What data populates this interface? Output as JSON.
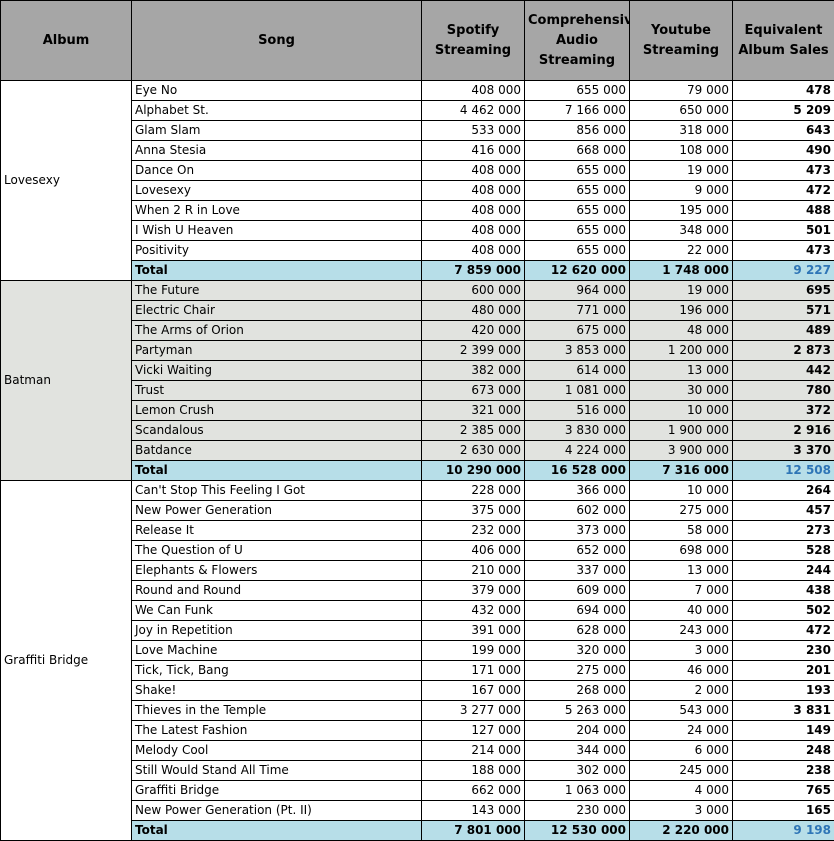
{
  "colors": {
    "header_bg": "#a6a6a6",
    "total_bg": "#b7dee8",
    "total_eas_text": "#2e75b6",
    "alt_group_bg": "#e1e3df",
    "border": "#000000"
  },
  "headers": {
    "album": "Album",
    "song": "Song",
    "spotify": [
      "Spotify",
      "Streaming"
    ],
    "caus": [
      "Comprehensive",
      "Audio",
      "Streaming"
    ],
    "youtube": [
      "Youtube",
      "Streaming"
    ],
    "eas": [
      "Equivalent",
      "Album Sales"
    ]
  },
  "albums": [
    {
      "name": "Lovesexy",
      "shaded": false,
      "songs": [
        {
          "song": "Eye No",
          "spotify": "408 000",
          "caus": "655 000",
          "youtube": "79 000",
          "eas": "478"
        },
        {
          "song": "Alphabet St.",
          "spotify": "4 462 000",
          "caus": "7 166 000",
          "youtube": "650 000",
          "eas": "5 209"
        },
        {
          "song": "Glam Slam",
          "spotify": "533 000",
          "caus": "856 000",
          "youtube": "318 000",
          "eas": "643"
        },
        {
          "song": "Anna Stesia",
          "spotify": "416 000",
          "caus": "668 000",
          "youtube": "108 000",
          "eas": "490"
        },
        {
          "song": "Dance On",
          "spotify": "408 000",
          "caus": "655 000",
          "youtube": "19 000",
          "eas": "473"
        },
        {
          "song": "Lovesexy",
          "spotify": "408 000",
          "caus": "655 000",
          "youtube": "9 000",
          "eas": "472"
        },
        {
          "song": "When 2 R in Love",
          "spotify": "408 000",
          "caus": "655 000",
          "youtube": "195 000",
          "eas": "488"
        },
        {
          "song": "I Wish U Heaven",
          "spotify": "408 000",
          "caus": "655 000",
          "youtube": "348 000",
          "eas": "501"
        },
        {
          "song": "Positivity",
          "spotify": "408 000",
          "caus": "655 000",
          "youtube": "22 000",
          "eas": "473"
        }
      ],
      "total": {
        "label": "Total",
        "spotify": "7 859 000",
        "caus": "12 620 000",
        "youtube": "1 748 000",
        "eas": "9 227"
      }
    },
    {
      "name": "Batman",
      "shaded": true,
      "songs": [
        {
          "song": "The Future",
          "spotify": "600 000",
          "caus": "964 000",
          "youtube": "19 000",
          "eas": "695"
        },
        {
          "song": "Electric Chair",
          "spotify": "480 000",
          "caus": "771 000",
          "youtube": "196 000",
          "eas": "571"
        },
        {
          "song": "The Arms of Orion",
          "spotify": "420 000",
          "caus": "675 000",
          "youtube": "48 000",
          "eas": "489"
        },
        {
          "song": "Partyman",
          "spotify": "2 399 000",
          "caus": "3 853 000",
          "youtube": "1 200 000",
          "eas": "2 873"
        },
        {
          "song": "Vicki Waiting",
          "spotify": "382 000",
          "caus": "614 000",
          "youtube": "13 000",
          "eas": "442"
        },
        {
          "song": "Trust",
          "spotify": "673 000",
          "caus": "1 081 000",
          "youtube": "30 000",
          "eas": "780"
        },
        {
          "song": "Lemon Crush",
          "spotify": "321 000",
          "caus": "516 000",
          "youtube": "10 000",
          "eas": "372"
        },
        {
          "song": "Scandalous",
          "spotify": "2 385 000",
          "caus": "3 830 000",
          "youtube": "1 900 000",
          "eas": "2 916"
        },
        {
          "song": "Batdance",
          "spotify": "2 630 000",
          "caus": "4 224 000",
          "youtube": "3 900 000",
          "eas": "3 370"
        }
      ],
      "total": {
        "label": "Total",
        "spotify": "10 290 000",
        "caus": "16 528 000",
        "youtube": "7 316 000",
        "eas": "12 508"
      }
    },
    {
      "name": "Graffiti Bridge",
      "shaded": false,
      "songs": [
        {
          "song": "Can't Stop This Feeling I Got",
          "spotify": "228 000",
          "caus": "366 000",
          "youtube": "10 000",
          "eas": "264"
        },
        {
          "song": "New Power Generation",
          "spotify": "375 000",
          "caus": "602 000",
          "youtube": "275 000",
          "eas": "457"
        },
        {
          "song": "Release It",
          "spotify": "232 000",
          "caus": "373 000",
          "youtube": "58 000",
          "eas": "273"
        },
        {
          "song": "The Question of U",
          "spotify": "406 000",
          "caus": "652 000",
          "youtube": "698 000",
          "eas": "528"
        },
        {
          "song": "Elephants & Flowers",
          "spotify": "210 000",
          "caus": "337 000",
          "youtube": "13 000",
          "eas": "244"
        },
        {
          "song": "Round and Round",
          "spotify": "379 000",
          "caus": "609 000",
          "youtube": "7 000",
          "eas": "438"
        },
        {
          "song": "We Can Funk",
          "spotify": "432 000",
          "caus": "694 000",
          "youtube": "40 000",
          "eas": "502"
        },
        {
          "song": "Joy in Repetition",
          "spotify": "391 000",
          "caus": "628 000",
          "youtube": "243 000",
          "eas": "472"
        },
        {
          "song": "Love Machine",
          "spotify": "199 000",
          "caus": "320 000",
          "youtube": "3 000",
          "eas": "230"
        },
        {
          "song": "Tick, Tick, Bang",
          "spotify": "171 000",
          "caus": "275 000",
          "youtube": "46 000",
          "eas": "201"
        },
        {
          "song": "Shake!",
          "spotify": "167 000",
          "caus": "268 000",
          "youtube": "2 000",
          "eas": "193"
        },
        {
          "song": "Thieves in the Temple",
          "spotify": "3 277 000",
          "caus": "5 263 000",
          "youtube": "543 000",
          "eas": "3 831"
        },
        {
          "song": "The Latest Fashion",
          "spotify": "127 000",
          "caus": "204 000",
          "youtube": "24 000",
          "eas": "149"
        },
        {
          "song": "Melody Cool",
          "spotify": "214 000",
          "caus": "344 000",
          "youtube": "6 000",
          "eas": "248"
        },
        {
          "song": "Still Would Stand All Time",
          "spotify": "188 000",
          "caus": "302 000",
          "youtube": "245 000",
          "eas": "238"
        },
        {
          "song": "Graffiti Bridge",
          "spotify": "662 000",
          "caus": "1 063 000",
          "youtube": "4 000",
          "eas": "765"
        },
        {
          "song": "New Power Generation (Pt. II)",
          "spotify": "143 000",
          "caus": "230 000",
          "youtube": "3 000",
          "eas": "165"
        }
      ],
      "total": {
        "label": "Total",
        "spotify": "7 801 000",
        "caus": "12 530 000",
        "youtube": "2 220 000",
        "eas": "9 198"
      }
    }
  ]
}
